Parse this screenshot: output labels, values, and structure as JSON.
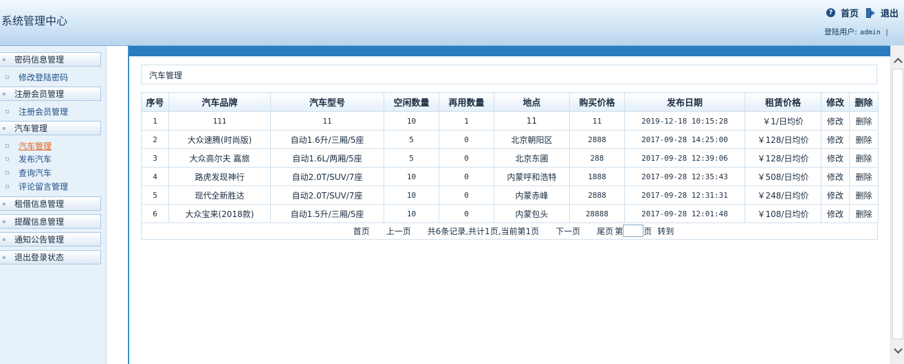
{
  "header": {
    "title": "系统管理中心",
    "home_label": "首页",
    "logout_label": "退出",
    "user_prefix": "登陆用户:",
    "user_name": "admin |",
    "help_glyph": "?"
  },
  "sidebar": {
    "groups": [
      {
        "label": "密码信息管理",
        "items": [
          "修改登陆密码"
        ]
      },
      {
        "label": "注册会员管理",
        "items": [
          "注册会员管理"
        ]
      },
      {
        "label": "汽车管理",
        "items": [
          "汽车管理",
          "发布汽车",
          "查询汽车",
          "评论留言管理"
        ],
        "active_item": "汽车管理"
      },
      {
        "label": "租借信息管理",
        "items": []
      },
      {
        "label": "提醒信息管理",
        "items": []
      },
      {
        "label": "通知公告管理",
        "items": []
      },
      {
        "label": "退出登录状态",
        "items": []
      }
    ]
  },
  "main": {
    "section_title": "汽车管理",
    "columns": [
      "序号",
      "汽车品牌",
      "汽车型号",
      "空闲数量",
      "再用数量",
      "地点",
      "购买价格",
      "发布日期",
      "租赁价格",
      "修改",
      "删除"
    ],
    "rows": [
      [
        "1",
        "111",
        "11",
        "10",
        "1",
        "11",
        "11",
        "2019-12-18 10:15:28",
        "￥1/日均价",
        "修改",
        "删除"
      ],
      [
        "2",
        "大众速腾(时尚版)",
        "自动1.6升/三厢/5座",
        "5",
        "0",
        "北京朝阳区",
        "2888",
        "2017-09-28 14:25:00",
        "￥128/日均价",
        "修改",
        "删除"
      ],
      [
        "3",
        "大众高尔夫 嘉旅",
        "自动1.6L/两厢/5座",
        "5",
        "0",
        "北京东圃",
        "288",
        "2017-09-28 12:39:06",
        "￥128/日均价",
        "修改",
        "删除"
      ],
      [
        "4",
        "路虎发现神行",
        "自动2.0T/SUV/7座",
        "10",
        "0",
        "内蒙呼和浩特",
        "1888",
        "2017-09-28 12:35:43",
        "￥508/日均价",
        "修改",
        "删除"
      ],
      [
        "5",
        "现代全新胜达",
        "自动2.0T/SUV/7座",
        "10",
        "0",
        "内蒙赤峰",
        "2888",
        "2017-09-28 12:31:31",
        "￥248/日均价",
        "修改",
        "删除"
      ],
      [
        "6",
        "大众宝来(2018款)",
        "自动1.5升/三厢/5座",
        "10",
        "0",
        "内蒙包头",
        "28888",
        "2017-09-28 12:01:48",
        "￥108/日均价",
        "修改",
        "删除"
      ]
    ],
    "pager": {
      "first": "首页",
      "prev": "上一页",
      "info": "共6条记录,共计1页,当前第1页",
      "next": "下一页",
      "last": "尾页",
      "page_prefix": "第",
      "page_suffix": "页",
      "goto": "转到",
      "page_value": ""
    }
  }
}
